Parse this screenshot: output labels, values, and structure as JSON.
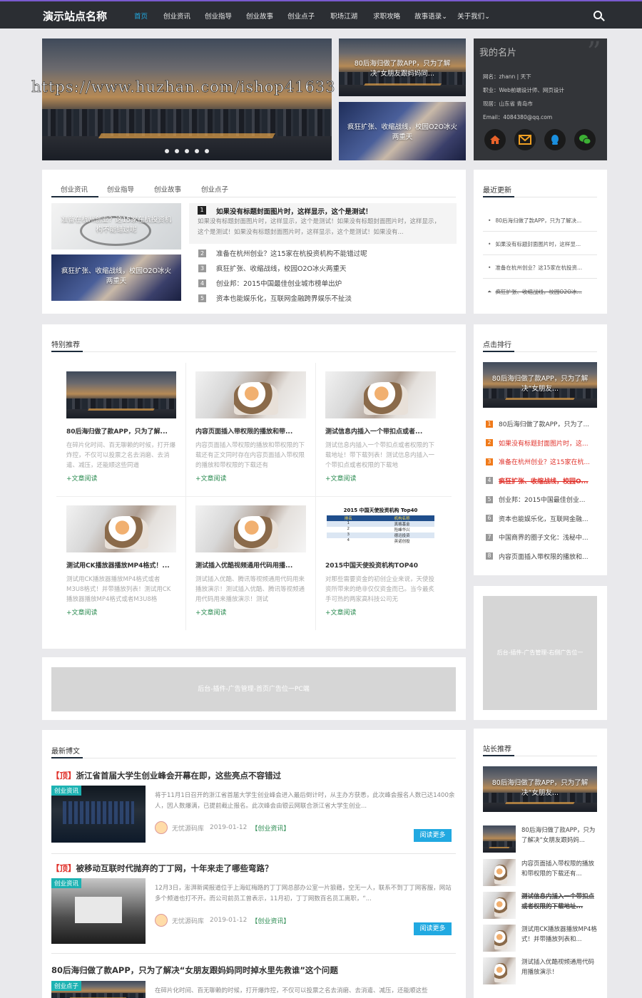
{
  "site": {
    "name": "演示站点名称"
  },
  "nav": {
    "items": [
      "首页",
      "创业资讯",
      "创业指导",
      "创业故事",
      "创业点子",
      "职场江湖",
      "求职攻略",
      "故事语录",
      "关于我们"
    ]
  },
  "watermark": "https://www.huzhan.com/ishop41633",
  "hero": {
    "side1": "80后海归做了款APP，只为了解决“女朋友跟妈妈同...",
    "side2": "疯狂扩张、收缩战线，校园O2O冰火两重天",
    "dots": 5
  },
  "profile": {
    "title": "我的名片",
    "name": "网名：zhann | 天下",
    "job": "职业：Web前端设计师、网页设计",
    "location": "现居：山东省 青岛市",
    "email": "Email：4084380@qq.com",
    "icons": [
      "home-icon",
      "mail-icon",
      "qq-icon",
      "wechat-icon"
    ],
    "colors": {
      "home": "#e9622a",
      "mail": "#f0a023",
      "qq": "#1a8fde",
      "wechat": "#3cb034"
    }
  },
  "tabs": {
    "items": [
      "创业资讯",
      "创业指导",
      "创业故事",
      "创业点子"
    ],
    "img1": "准备在杭州创业？这15家在杭投资机构不能错过呢",
    "img2": "疯狂扩张、收缩战线，校园O2O冰火两重天",
    "top_title": "如果没有标题封面图片时，这样显示，这个是测试！",
    "top_desc": "如果没有标题封面图片时，这样显示，这个是测试！如果没有标题封面图片时，这样显示，这个是测试！如果没有标题封面图片时，这样显示，这个是测试！如果没有...",
    "list": [
      {
        "n": "1",
        "t": "如果没有标题封面图片时，这样显示，这个是测试！"
      },
      {
        "n": "2",
        "t": "准备在杭州创业？这15家在杭投资机构不能错过呢"
      },
      {
        "n": "3",
        "t": "疯狂扩张、收缩战线，校园O2O冰火两重天"
      },
      {
        "n": "4",
        "t": "创业邦：2015中国最佳创业城市榜单出炉"
      },
      {
        "n": "5",
        "t": "资本也能娱乐化，互联网金融跨界娱乐不扯淡"
      }
    ]
  },
  "latest": {
    "title": "最近更新",
    "items": [
      "80后海归做了款APP，只为了解决...",
      "如果没有标题封面图片时，这样显...",
      "准备在杭州创业？这15家在杭投资...",
      "疯狂扩张、收缩战线，校园O2O冰..."
    ]
  },
  "featured": {
    "title": "特别推荐",
    "more": "+文章阅读",
    "items": [
      {
        "t": "80后海归做了款APP，只为了解...",
        "d": "在碎片化时间、百无聊赖的时候，打开爆炸控，不仅可以投票之名去消磨、去消遣、减压，还能顺这些同道"
      },
      {
        "t": "内容页面插入带权限的播放和带...",
        "d": "内容页面插入带权限的播放和带权限的下载还有正文同时存在内容页面插入带权限的播放和带权限的下载还有"
      },
      {
        "t": "测试信息内插入一个带扣点或者...",
        "d": "测试信息内插入一个带扣点或者权限的下载地址！带下载列表！测试信息内插入一个带扣点或者权限的下载地"
      },
      {
        "t": "测试用CK播放器播放MP4格式！...",
        "d": "测试用CK播放器播放MP4格式或者M3U8格式！并带播放列表！测试用CK播放器播放MP4格式或者M3U8格"
      },
      {
        "t": "测试插入优酷视频通用代码用播...",
        "d": "测试插入优酷、腾讯等视频通用代码用来播放演示！测试插入优酷、腾讯等视频通用代码用来播放演示！测试"
      },
      {
        "t": "2015中国天使投资机构TOP40",
        "d": "对那些需要资金的初创企业来说，天使投资所带来的绝非仅仅资金而已。当今最炙手可热的两家高科技公司无"
      }
    ],
    "table": {
      "title": "2015 中国天使投资机构 Top40",
      "headers": [
        "排名",
        "机构名称"
      ],
      "rows": [
        [
          "1",
          "真格基金"
        ],
        [
          "2",
          "险峰华兴"
        ],
        [
          "3",
          "德迅投资"
        ],
        [
          "4",
          "英诺创投"
        ]
      ]
    }
  },
  "ranking": {
    "title": "点击排行",
    "img": "80后海归做了款APP，只为了解决“女朋友...",
    "items": [
      {
        "n": "1",
        "t": "80后海归做了款APP，只为了..."
      },
      {
        "n": "2",
        "t": "如果没有标题封面图片时，这..."
      },
      {
        "n": "3",
        "t": "准备在杭州创业？这15家在杭..."
      },
      {
        "n": "4",
        "t": "疯狂扩张、收缩战线，校园O..."
      },
      {
        "n": "5",
        "t": "创业邦：2015中国最佳创业..."
      },
      {
        "n": "6",
        "t": "资本也能娱乐化，互联网金融..."
      },
      {
        "n": "7",
        "t": "中国商界的圈子文化：浅秘中..."
      },
      {
        "n": "8",
        "t": "内容页面插入带权限的播放和..."
      }
    ],
    "colors": [
      "#f07a1a",
      "#f07a1a",
      "#f07a1a",
      "#999999",
      "#999999",
      "#999999",
      "#999999",
      "#999999"
    ]
  },
  "ads": {
    "home": "后台-插件-广告管理-首页广告位一PC端",
    "side": "后台-插件-广告管理-右侧广告位一"
  },
  "blog": {
    "title": "最新博文",
    "read_more": "阅读更多",
    "posts": [
      {
        "title": "【顶】浙江省首届大学生创业峰会开幕在即，这些亮点不容错过",
        "tag": "创业资讯",
        "desc": "将于11月1日召开的浙江省首届大学生创业峰会进入最后倒计时，从主办方获悉，此次峰会报名人数已达1400余人，因人数爆满，已提前截止报名。此次峰会由银云网联合浙江省大学生创业...",
        "author": "无忧源码库",
        "date": "2019-01-12",
        "cat": "【创业资讯】"
      },
      {
        "title": "【顶】被移动互联时代抛弃的丁丁网，十年来走了哪些弯路？",
        "tag": "创业资讯",
        "desc": "12月3日，澎湃新闻报道位于上海虹梅路的丁丁网总部办公室一片狼藉，空无一人，联系不到丁丁网客服，网站多个频道也打不开。而公司前员工曾表示，11月初，丁丁网数百名员工离职，“...",
        "author": "无忧源码库",
        "date": "2019-01-12",
        "cat": "【创业资讯】"
      },
      {
        "title": "80后海归做了款APP，只为了解决“女朋友跟妈妈同时掉水里先救谁”这个问题",
        "tag": "创业点子",
        "desc": "在碎片化时间、百无聊赖的时候，打开爆炸控，不仅可以投票之名去消磨、去消遣、减压，还能顺这些"
      }
    ]
  },
  "recommend": {
    "title": "站长推荐",
    "img": "80后海归做了款APP，只为了解决“女朋友...",
    "items": [
      "80后海归做了款APP，只为了解决“女朋友跟妈妈...",
      "内容页面插入带权限的播放和带权限的下载还有...",
      "测试信息内插入一个带扣点或者权限的下载地址...",
      "测试用CK播放器播放MP4格式！并带播放列表和...",
      "测试插入优酷视频通用代码用播放演示！"
    ]
  }
}
